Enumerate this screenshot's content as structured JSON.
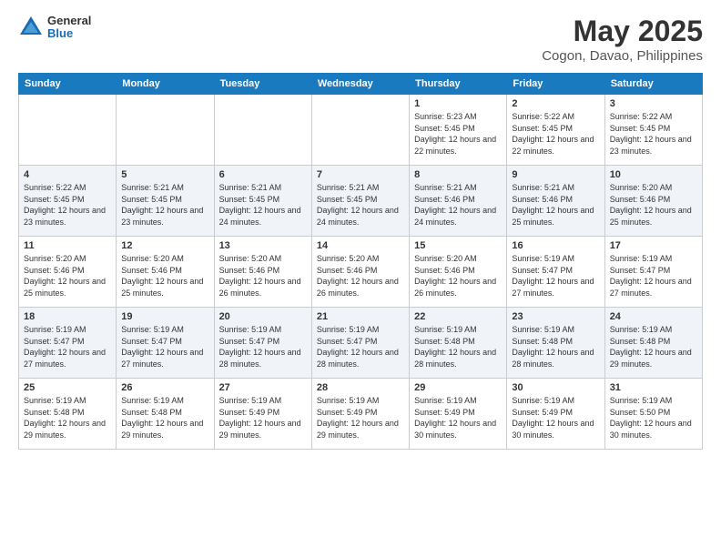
{
  "logo": {
    "general": "General",
    "blue": "Blue"
  },
  "header": {
    "title": "May 2025",
    "subtitle": "Cogon, Davao, Philippines"
  },
  "days_of_week": [
    "Sunday",
    "Monday",
    "Tuesday",
    "Wednesday",
    "Thursday",
    "Friday",
    "Saturday"
  ],
  "weeks": [
    [
      {
        "day": "",
        "info": ""
      },
      {
        "day": "",
        "info": ""
      },
      {
        "day": "",
        "info": ""
      },
      {
        "day": "",
        "info": ""
      },
      {
        "day": "1",
        "info": "Sunrise: 5:23 AM\nSunset: 5:45 PM\nDaylight: 12 hours\nand 22 minutes."
      },
      {
        "day": "2",
        "info": "Sunrise: 5:22 AM\nSunset: 5:45 PM\nDaylight: 12 hours\nand 22 minutes."
      },
      {
        "day": "3",
        "info": "Sunrise: 5:22 AM\nSunset: 5:45 PM\nDaylight: 12 hours\nand 23 minutes."
      }
    ],
    [
      {
        "day": "4",
        "info": "Sunrise: 5:22 AM\nSunset: 5:45 PM\nDaylight: 12 hours\nand 23 minutes."
      },
      {
        "day": "5",
        "info": "Sunrise: 5:21 AM\nSunset: 5:45 PM\nDaylight: 12 hours\nand 23 minutes."
      },
      {
        "day": "6",
        "info": "Sunrise: 5:21 AM\nSunset: 5:45 PM\nDaylight: 12 hours\nand 24 minutes."
      },
      {
        "day": "7",
        "info": "Sunrise: 5:21 AM\nSunset: 5:45 PM\nDaylight: 12 hours\nand 24 minutes."
      },
      {
        "day": "8",
        "info": "Sunrise: 5:21 AM\nSunset: 5:46 PM\nDaylight: 12 hours\nand 24 minutes."
      },
      {
        "day": "9",
        "info": "Sunrise: 5:21 AM\nSunset: 5:46 PM\nDaylight: 12 hours\nand 25 minutes."
      },
      {
        "day": "10",
        "info": "Sunrise: 5:20 AM\nSunset: 5:46 PM\nDaylight: 12 hours\nand 25 minutes."
      }
    ],
    [
      {
        "day": "11",
        "info": "Sunrise: 5:20 AM\nSunset: 5:46 PM\nDaylight: 12 hours\nand 25 minutes."
      },
      {
        "day": "12",
        "info": "Sunrise: 5:20 AM\nSunset: 5:46 PM\nDaylight: 12 hours\nand 25 minutes."
      },
      {
        "day": "13",
        "info": "Sunrise: 5:20 AM\nSunset: 5:46 PM\nDaylight: 12 hours\nand 26 minutes."
      },
      {
        "day": "14",
        "info": "Sunrise: 5:20 AM\nSunset: 5:46 PM\nDaylight: 12 hours\nand 26 minutes."
      },
      {
        "day": "15",
        "info": "Sunrise: 5:20 AM\nSunset: 5:46 PM\nDaylight: 12 hours\nand 26 minutes."
      },
      {
        "day": "16",
        "info": "Sunrise: 5:19 AM\nSunset: 5:47 PM\nDaylight: 12 hours\nand 27 minutes."
      },
      {
        "day": "17",
        "info": "Sunrise: 5:19 AM\nSunset: 5:47 PM\nDaylight: 12 hours\nand 27 minutes."
      }
    ],
    [
      {
        "day": "18",
        "info": "Sunrise: 5:19 AM\nSunset: 5:47 PM\nDaylight: 12 hours\nand 27 minutes."
      },
      {
        "day": "19",
        "info": "Sunrise: 5:19 AM\nSunset: 5:47 PM\nDaylight: 12 hours\nand 27 minutes."
      },
      {
        "day": "20",
        "info": "Sunrise: 5:19 AM\nSunset: 5:47 PM\nDaylight: 12 hours\nand 28 minutes."
      },
      {
        "day": "21",
        "info": "Sunrise: 5:19 AM\nSunset: 5:47 PM\nDaylight: 12 hours\nand 28 minutes."
      },
      {
        "day": "22",
        "info": "Sunrise: 5:19 AM\nSunset: 5:48 PM\nDaylight: 12 hours\nand 28 minutes."
      },
      {
        "day": "23",
        "info": "Sunrise: 5:19 AM\nSunset: 5:48 PM\nDaylight: 12 hours\nand 28 minutes."
      },
      {
        "day": "24",
        "info": "Sunrise: 5:19 AM\nSunset: 5:48 PM\nDaylight: 12 hours\nand 29 minutes."
      }
    ],
    [
      {
        "day": "25",
        "info": "Sunrise: 5:19 AM\nSunset: 5:48 PM\nDaylight: 12 hours\nand 29 minutes."
      },
      {
        "day": "26",
        "info": "Sunrise: 5:19 AM\nSunset: 5:48 PM\nDaylight: 12 hours\nand 29 minutes."
      },
      {
        "day": "27",
        "info": "Sunrise: 5:19 AM\nSunset: 5:49 PM\nDaylight: 12 hours\nand 29 minutes."
      },
      {
        "day": "28",
        "info": "Sunrise: 5:19 AM\nSunset: 5:49 PM\nDaylight: 12 hours\nand 29 minutes."
      },
      {
        "day": "29",
        "info": "Sunrise: 5:19 AM\nSunset: 5:49 PM\nDaylight: 12 hours\nand 30 minutes."
      },
      {
        "day": "30",
        "info": "Sunrise: 5:19 AM\nSunset: 5:49 PM\nDaylight: 12 hours\nand 30 minutes."
      },
      {
        "day": "31",
        "info": "Sunrise: 5:19 AM\nSunset: 5:50 PM\nDaylight: 12 hours\nand 30 minutes."
      }
    ]
  ]
}
